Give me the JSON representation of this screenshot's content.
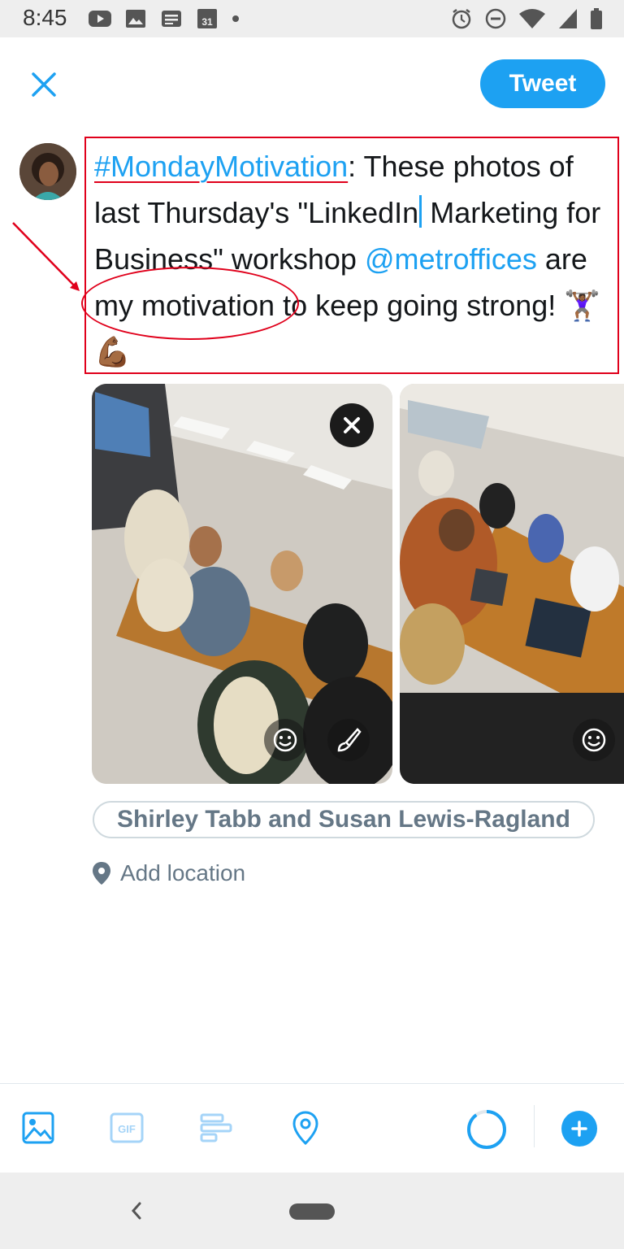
{
  "status_bar": {
    "time": "8:45",
    "icons_left": [
      "youtube-icon",
      "image-icon",
      "news-icon",
      "calendar-icon",
      "dot-icon"
    ],
    "calendar_day": "31",
    "icons_right": [
      "alarm-icon",
      "dnd-icon",
      "wifi-icon",
      "signal-icon",
      "battery-icon"
    ]
  },
  "header": {
    "tweet_label": "Tweet",
    "close_icon": "close-icon"
  },
  "composer": {
    "hashtag": "#MondayMotivation",
    "text_1": ": These photos of last Thursday's \"LinkedIn",
    "text_2": " Marketing for Business\" workshop ",
    "mention": "@metroffices",
    "text_3": " are my motivation to keep going strong! ",
    "emoji": "🏋🏾‍♀️💪🏾"
  },
  "media": {
    "photo_count": 2,
    "photo_1_controls": [
      "remove-icon",
      "sticker-icon",
      "edit-brush-icon"
    ],
    "photo_2_controls": [
      "sticker-icon"
    ]
  },
  "tags": {
    "tagged_people": "Shirley Tabb and Susan Lewis-Ragland",
    "add_location": "Add location"
  },
  "toolbar": {
    "buttons": [
      "photo-icon",
      "gif-icon",
      "poll-icon",
      "location-icon"
    ],
    "gif_label": "GIF",
    "char_progress": 0.9
  },
  "colors": {
    "accent": "#1da1f2",
    "annotation": "#e0001b",
    "muted_text": "#657786"
  }
}
